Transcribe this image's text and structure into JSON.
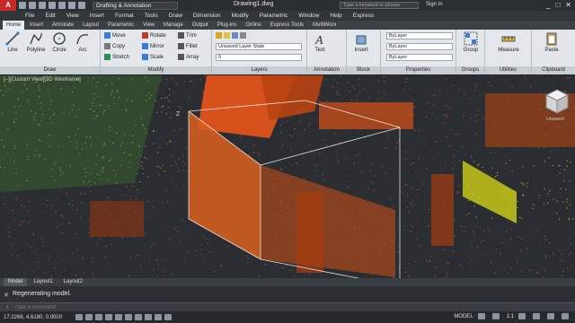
{
  "titlebar": {
    "app_logo": "A",
    "workspace": "Drafting & Annotation",
    "title": "Drawing1.dwg",
    "search_placeholder": "Type a keyword or phrase",
    "signin": "Sign In",
    "win_min": "_",
    "win_max": "□",
    "win_close": "✕"
  },
  "menu": [
    "File",
    "Edit",
    "View",
    "Insert",
    "Format",
    "Tools",
    "Draw",
    "Dimension",
    "Modify",
    "Parametric",
    "Window",
    "Help",
    "Express"
  ],
  "tabs": [
    "Home",
    "Insert",
    "Annotate",
    "Layout",
    "Parametric",
    "View",
    "Manage",
    "Output",
    "Plug-ins",
    "Online",
    "Express Tools",
    "MultiWorx"
  ],
  "ribbon": {
    "draw": {
      "title": "Draw",
      "line": "Line",
      "polyline": "Polyline",
      "circle": "Circle",
      "arc": "Arc"
    },
    "modify": {
      "title": "Modify",
      "move": "Move",
      "rotate": "Rotate",
      "trim": "Trim",
      "copy": "Copy",
      "mirror": "Mirror",
      "fillet": "Fillet",
      "stretch": "Stretch",
      "scale": "Scale",
      "array": "Array"
    },
    "layers": {
      "title": "Layers",
      "state": "Unsaved Layer State",
      "current": "0"
    },
    "annotation": {
      "title": "Annotation",
      "text": "Text"
    },
    "block": {
      "title": "Block",
      "insert": "Insert"
    },
    "properties": {
      "title": "Properties",
      "color": "ByLayer",
      "linetype": "ByLayer",
      "lineweight": "ByLayer"
    },
    "groups": {
      "title": "Groups",
      "group": "Group"
    },
    "utilities": {
      "title": "Utilities",
      "measure": "Measure"
    },
    "clipboard": {
      "title": "Clipboard",
      "paste": "Paste"
    }
  },
  "viewport": {
    "label": "[−][Custom View][3D Wireframe]",
    "viewcube_caption": "Unsaved",
    "ucs_label": "Z"
  },
  "layout_tabs": [
    "Model",
    "Layout1",
    "Layout2"
  ],
  "command": {
    "history": "Regenerating model.",
    "placeholder": "Type a command",
    "close": "✕"
  },
  "status": {
    "coords": "17.2266, 4.6180, 0.0000",
    "model": "MODEL",
    "scale": "1:1"
  },
  "colors": {
    "viewport_bg": "#2a2e33",
    "point_orange": "#e8551c",
    "point_yellow": "#d9d21a",
    "point_green": "#6fbf2a"
  }
}
